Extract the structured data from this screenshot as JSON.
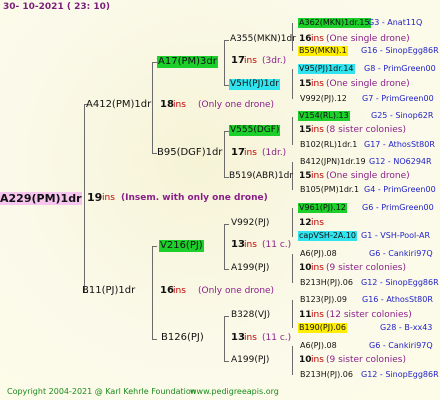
{
  "date": "30- 10-2021 ( 23: 10)",
  "root": {
    "id": "A229(PM)1dr",
    "ins": "19",
    "ins_word": "ins",
    "note": "(Insem. with only one drone)"
  },
  "gen1": [
    {
      "id": "A412(PM)1dr",
      "ins": "18",
      "note": "(Only one drone)"
    },
    {
      "id": "B11(PJ)1dr",
      "ins": "16",
      "note": "(Only one drone)"
    }
  ],
  "gen2": [
    {
      "id": "A17(PM)3dr",
      "ins": "17",
      "note": "(3dr.)"
    },
    {
      "id": "B95(DGF)1dr",
      "ins": "17",
      "note": "(1dr.)"
    },
    {
      "id": "V216(PJ)",
      "ins": "13",
      "note": "(11 c.)"
    },
    {
      "id": "B126(PJ)",
      "ins": "13",
      "note": "(11 c.)"
    }
  ],
  "gen3": [
    {
      "id": "A355(MKN)1dr",
      "ins": "16",
      "note": "(One single drone)"
    },
    {
      "id": "V5H(PJ)1dr",
      "ins": "15",
      "note": "(One single drone)"
    },
    {
      "id": "V555(DGF)",
      "ins": "15",
      "note": "(8 sister colonies)"
    },
    {
      "id": "B519(ABR)1dr",
      "ins": "15",
      "note": "(One single drone)"
    },
    {
      "id": "V992(PJ)",
      "ins": "12",
      "note": ""
    },
    {
      "id": "A199(PJ)",
      "ins": "10",
      "note": "(9 sister colonies)"
    },
    {
      "id": "B328(VJ)",
      "ins": "11",
      "note": "(12 sister colonies)"
    },
    {
      "id": "A199(PJ)",
      "ins": "10",
      "note": "(9 sister colonies)"
    }
  ],
  "gen4": [
    {
      "id": "A362(MKN)1dr.15",
      "info": "G3 - Anat11Q"
    },
    {
      "id": "B59(MKN).1",
      "info": "G16 - SinopEgg86R"
    },
    {
      "id": "V95(PJ)1dr.14",
      "info": "G8 - PrimGreen00"
    },
    {
      "id": "V992(PJ).12",
      "info": "G7 - PrimGreen00"
    },
    {
      "id": "V154(RL).13",
      "info": "G25 - Sinop62R"
    },
    {
      "id": "B102(RL)1dr.1",
      "info": "G17 - AthosSt80R"
    },
    {
      "id": "B412(JPN)1dr.19",
      "info": "G12 - NO6294R"
    },
    {
      "id": "B105(PM)1dr.1",
      "info": "G4 - PrimGreen00"
    },
    {
      "id": "V961(PJ).12",
      "info": "G6 - PrimGreen00"
    },
    {
      "id": "capVSH-2A.10",
      "info": "G1 - VSH-Pool-AR"
    },
    {
      "id": "A6(PJ).08",
      "info": "G6 - Cankiri97Q"
    },
    {
      "id": "B213H(PJ).06",
      "info": "G12 - SinopEgg86R"
    },
    {
      "id": "B123(PJ).09",
      "info": "G16 - AthosSt80R"
    },
    {
      "id": "B190(PJ).06",
      "info": "G28 - B-xx43"
    },
    {
      "id": "A6(PJ).08",
      "info": "G6 - Cankiri97Q"
    },
    {
      "id": "B213H(PJ).06",
      "info": "G12 - SinopEgg86R"
    }
  ],
  "copyright": "Copyright 2004-2021 @ Karl Kehrle Foundation",
  "website": "www.pedigreeapis.org",
  "colors": {
    "green": "#1ccf2a",
    "cyan": "#2fe3ef",
    "yellow": "#ffee00",
    "pink": "#f7c6ef",
    "ins_red": "#c00000",
    "link_blue": "#2222c8",
    "footer_green": "#1c8a1c"
  }
}
